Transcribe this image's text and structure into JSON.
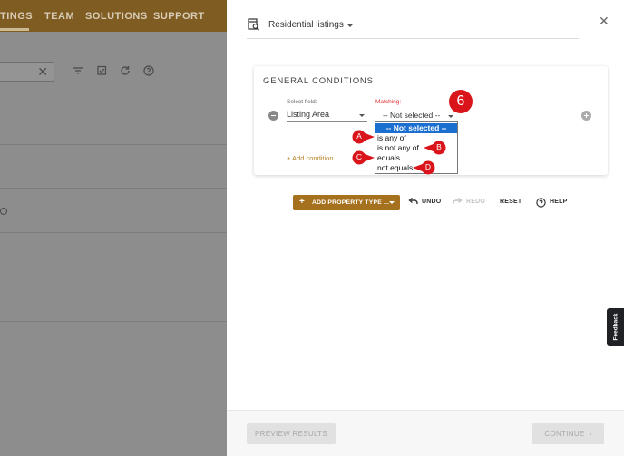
{
  "background": {
    "nav": [
      "TINGS",
      "TEAM",
      "SOLUTIONS",
      "SUPPORT"
    ],
    "search_clear": "✕"
  },
  "panel": {
    "title": "Residential listings",
    "close": "✕",
    "card": {
      "heading": "GENERAL CONDITIONS",
      "select_field_label": "Select field:",
      "select_field_value": "Listing Area",
      "matching_label": "Matching:",
      "matching_value": "-- Not selected --",
      "add_condition": "+ Add condition"
    },
    "dropdown": {
      "options": [
        "-- Not selected --",
        "is any of",
        "is not any of",
        "equals",
        "not equals"
      ],
      "selected_index": 0
    },
    "annotations": {
      "step": "6",
      "letters": [
        "A",
        "B",
        "C",
        "D"
      ]
    },
    "toolbar": {
      "add_property_type": "ADD PROPERTY TYPE ...",
      "undo": "UNDO",
      "redo": "REDO",
      "reset": "RESET",
      "help": "HELP"
    },
    "footer": {
      "preview": "PREVIEW RESULTS",
      "continue": "CONTINUE"
    }
  },
  "feedback": "Feedback",
  "colors": {
    "brand": "#a6711f",
    "selection": "#1a6fd0",
    "marker": "#d9141b",
    "error": "#e03030"
  }
}
